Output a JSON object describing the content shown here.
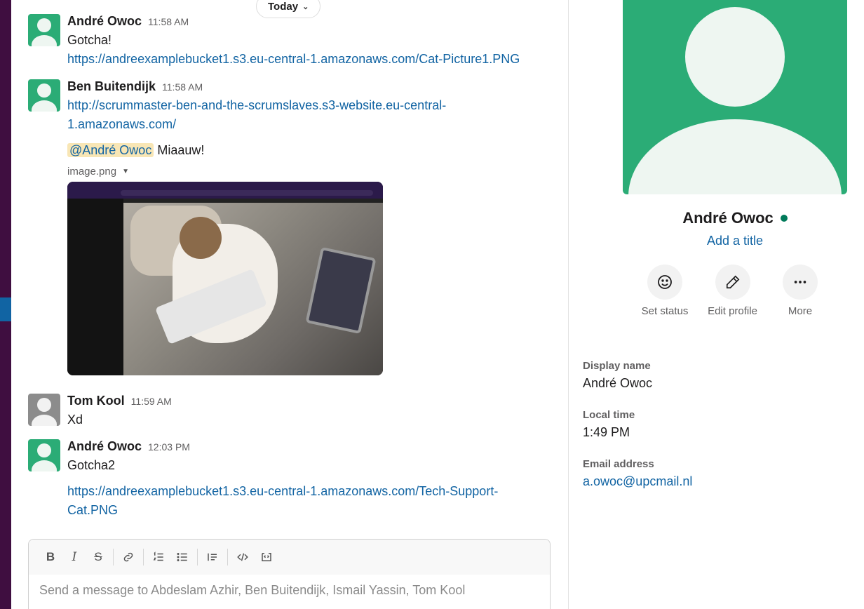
{
  "date_divider": {
    "label": "Today"
  },
  "messages": [
    {
      "sender": "André Owoc",
      "time": "11:58 AM",
      "text": "Gotcha!",
      "link": "https://andreexamplebucket1.s3.eu-central-1.amazonaws.com/Cat-Picture1.PNG"
    },
    {
      "sender": "Ben Buitendijk",
      "time": "11:58 AM",
      "link_line1": "http://scrummaster-ben-and-the-scrumslaves.s3-website.eu-central-",
      "link_line2": "1.amazonaws.com/",
      "mention": "@André Owoc",
      "text": "Miaauw!",
      "attachment_name": "image.png"
    },
    {
      "sender": "Tom Kool",
      "time": "11:59 AM",
      "text": "Xd"
    },
    {
      "sender": "André Owoc",
      "time": "12:03 PM",
      "text": "Gotcha2",
      "link_line1": "https://andreexamplebucket1.s3.eu-central-1.amazonaws.com/Tech-Support-",
      "link_line2": "Cat.PNG"
    }
  ],
  "composer": {
    "placeholder": "Send a message to Abdeslam Azhir, Ben Buitendijk, Ismail Yassin, Tom Kool",
    "tools": [
      "B",
      "I",
      "S"
    ]
  },
  "profile": {
    "name": "André Owoc",
    "status": "active",
    "status_color": "#007a5a",
    "add_title": "Add a title",
    "actions": [
      {
        "label": "Set status",
        "icon": "smiley-icon"
      },
      {
        "label": "Edit profile",
        "icon": "pencil-icon"
      },
      {
        "label": "More",
        "icon": "more-horizontal-icon"
      }
    ],
    "fields": {
      "display_name_label": "Display name",
      "display_name": "André Owoc",
      "local_time_label": "Local time",
      "local_time": "1:49 PM",
      "email_label": "Email address",
      "email": "a.owoc@upcmail.nl"
    }
  },
  "colors": {
    "sidebar": "#3f0e40",
    "link": "#1264a3",
    "avatar_green": "#2bac76",
    "mention_bg": "#f8e6b5"
  }
}
